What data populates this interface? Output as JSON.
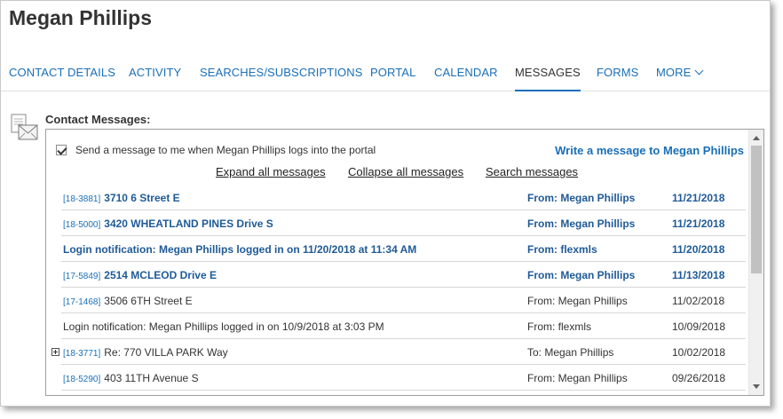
{
  "header": {
    "title": "Megan Phillips"
  },
  "tabs": [
    {
      "label": "CONTACT DETAILS"
    },
    {
      "label": "ACTIVITY"
    },
    {
      "label": "SEARCHES/SUBSCRIPTIONS"
    },
    {
      "label": "PORTAL"
    },
    {
      "label": "CALENDAR"
    },
    {
      "label": "MESSAGES"
    },
    {
      "label": "FORMS"
    },
    {
      "label": "MORE"
    }
  ],
  "section": {
    "label": "Contact Messages:"
  },
  "notify": {
    "label": "Send a message to me when Megan Phillips logs into the portal",
    "checked": true
  },
  "write_link": "Write a message to Megan Phillips",
  "actions": {
    "expand": "Expand all messages",
    "collapse": "Collapse all messages",
    "search": "Search messages"
  },
  "messages": [
    {
      "mls": "[18-3881]",
      "subject": "3710 6 Street E",
      "from": "From: Megan Phillips",
      "date": "11/21/2018",
      "unread": true
    },
    {
      "mls": "[18-5000]",
      "subject": "3420 WHEATLAND PINES Drive S",
      "from": "From: Megan Phillips",
      "date": "11/21/2018",
      "unread": true
    },
    {
      "mls": "",
      "subject": "Login notification: Megan Phillips logged in on 11/20/2018 at 11:34 AM",
      "from": "From: flexmls",
      "date": "11/20/2018",
      "unread": true
    },
    {
      "mls": "[17-5849]",
      "subject": "2514 MCLEOD Drive E",
      "from": "From: Megan Phillips",
      "date": "11/13/2018",
      "unread": true
    },
    {
      "mls": "[17-1468]",
      "subject": "3506 6TH Street E",
      "from": "From: Megan Phillips",
      "date": "11/02/2018",
      "unread": false
    },
    {
      "mls": "",
      "subject": "Login notification: Megan Phillips logged in on 10/9/2018 at 3:03 PM",
      "from": "From: flexmls",
      "date": "10/09/2018",
      "unread": false
    },
    {
      "mls": "[18-3771]",
      "subject": "Re: 770 VILLA PARK Way",
      "from": "To: Megan Phillips",
      "date": "10/02/2018",
      "unread": false,
      "expandable": true
    },
    {
      "mls": "[18-5290]",
      "subject": "403 11TH Avenue S",
      "from": "From: Megan Phillips",
      "date": "09/26/2018",
      "unread": false
    }
  ],
  "colors": {
    "link": "#1a6fb7",
    "unread_text": "#1f5a96",
    "text": "#333333"
  },
  "icons": {
    "section": "envelope-stack-icon",
    "more": "chevron-down-icon"
  }
}
